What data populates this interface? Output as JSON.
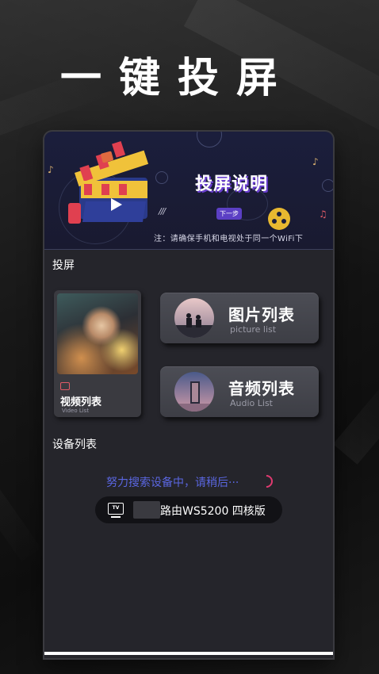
{
  "headline": "一键投屏",
  "banner": {
    "title": "投屏说明",
    "next_label": "下一步",
    "slashes": "///",
    "note": "注：请确保手机和电视处于同一个WiFi下",
    "colors": {
      "accent": "#5b3fc4",
      "background": "#1b1e3c"
    }
  },
  "cast_section": {
    "label": "投屏",
    "video_card": {
      "title": "视频列表",
      "subtitle": "Video List",
      "icon": "video-icon"
    },
    "picture_card": {
      "title": "图片列表",
      "subtitle": "picture list",
      "icon": "picture-avatar"
    },
    "audio_card": {
      "title": "音频列表",
      "subtitle": "Audio List",
      "icon": "audio-avatar"
    }
  },
  "device_section": {
    "label": "设备列表",
    "status": "努力搜索设备中，请稍后···",
    "status_color": "#5a66e0",
    "device": {
      "icon": "tv-icon",
      "icon_text": "TV",
      "name": "路由WS5200 四核版"
    }
  }
}
